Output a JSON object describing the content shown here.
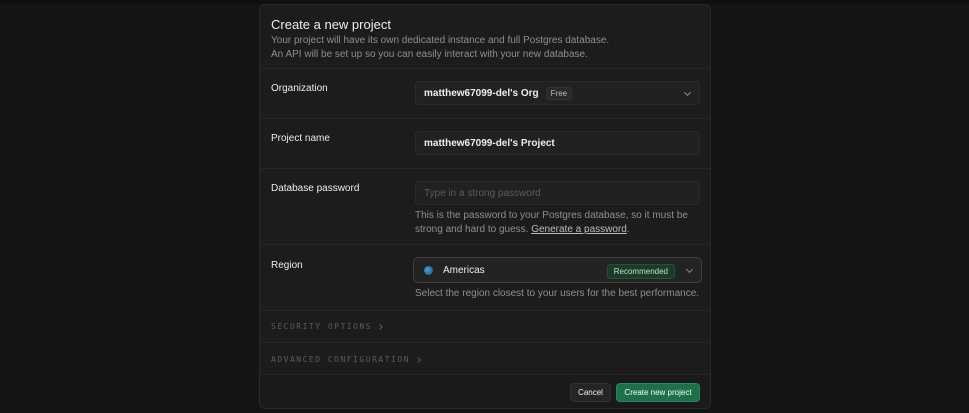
{
  "header": {
    "title": "Create a new project",
    "desc_line1": "Your project will have its own dedicated instance and full Postgres database.",
    "desc_line2": "An API will be set up so you can easily interact with your new database."
  },
  "organization": {
    "label": "Organization",
    "value": "matthew67099-del's Org",
    "plan_badge": "Free",
    "icon": "chevron-down-icon"
  },
  "project_name": {
    "label": "Project name",
    "value": "matthew67099-del's Project"
  },
  "database_password": {
    "label": "Database password",
    "placeholder": "Type in a strong password",
    "help_text": "This is the password to your Postgres database, so it must be strong and hard to guess.",
    "generate_link": "Generate a password",
    "help_suffix": "."
  },
  "region": {
    "label": "Region",
    "value": "Americas",
    "badge": "Recommended",
    "help_text": "Select the region closest to your users for the best performance.",
    "icon": "globe-icon"
  },
  "sections": {
    "security_options": "SECURITY OPTIONS",
    "advanced_configuration": "ADVANCED CONFIGURATION"
  },
  "footer": {
    "cancel_label": "Cancel",
    "create_label": "Create new project"
  },
  "colors": {
    "background": "#141414",
    "card": "#1c1c1c",
    "primary_button": "#1f6f4a",
    "recommended_badge": "#1e3a2c"
  }
}
